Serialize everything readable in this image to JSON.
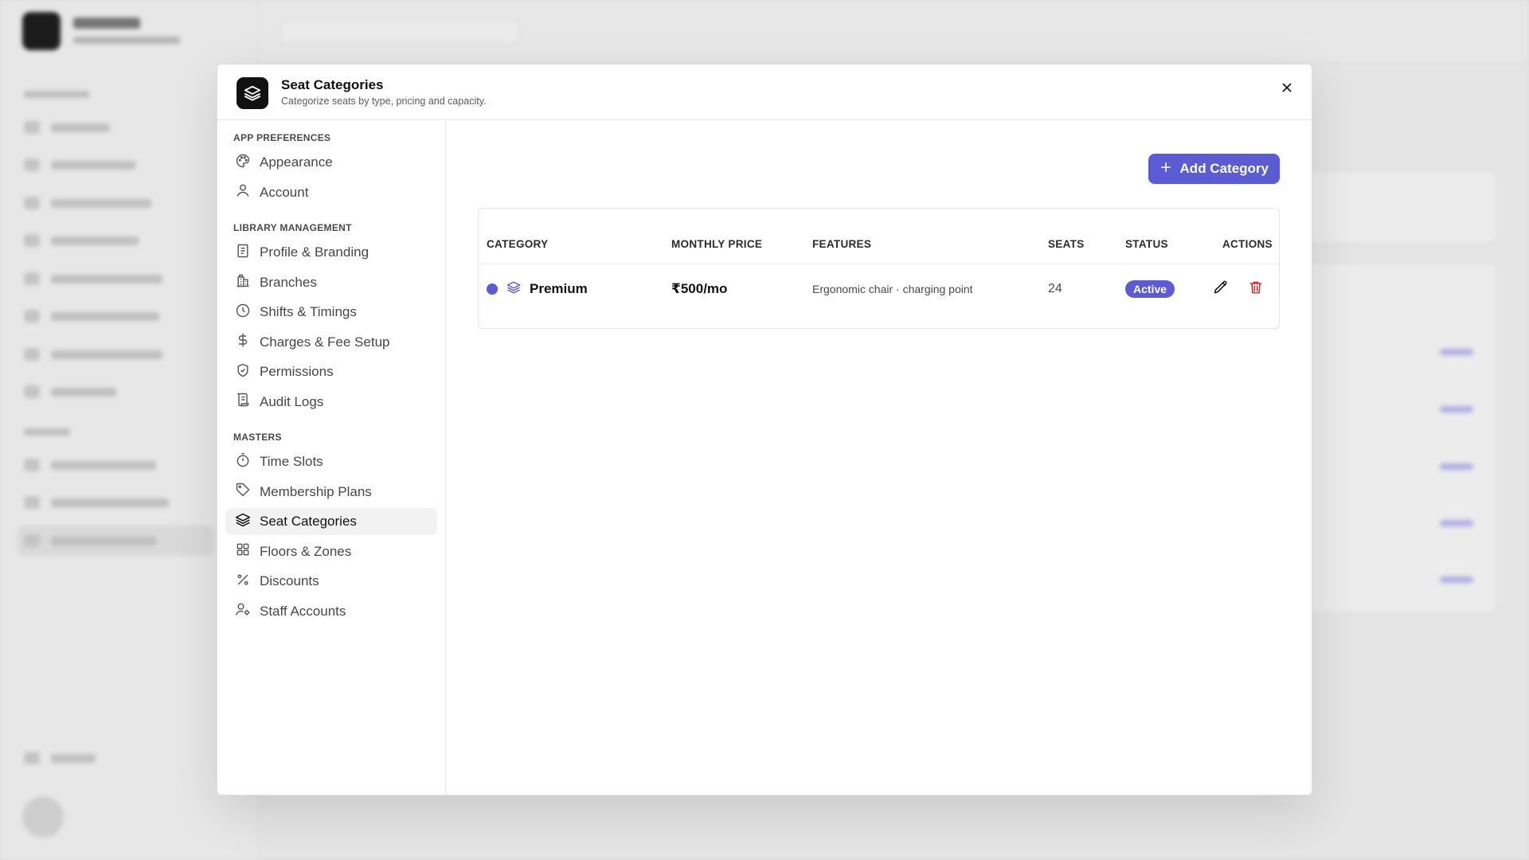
{
  "dialog": {
    "title": "Seat Categories",
    "subtitle": "Categorize seats by type, pricing and capacity.",
    "icon": "layers-icon",
    "close_icon": "close-icon"
  },
  "nav": {
    "sections": [
      {
        "title": "APP PREFERENCES",
        "items": [
          {
            "label": "Appearance",
            "icon": "palette-icon"
          },
          {
            "label": "Account",
            "icon": "user-icon"
          }
        ]
      },
      {
        "title": "LIBRARY MANAGEMENT",
        "items": [
          {
            "label": "Profile & Branding",
            "icon": "document-icon"
          },
          {
            "label": "Branches",
            "icon": "building-icon"
          },
          {
            "label": "Shifts & Timings",
            "icon": "clock-icon"
          },
          {
            "label": "Charges & Fee Setup",
            "icon": "dollar-icon"
          },
          {
            "label": "Permissions",
            "icon": "shield-icon"
          },
          {
            "label": "Audit Logs",
            "icon": "scroll-icon"
          }
        ]
      },
      {
        "title": "MASTERS",
        "items": [
          {
            "label": "Time Slots",
            "icon": "timer-icon"
          },
          {
            "label": "Membership Plans",
            "icon": "tag-icon"
          },
          {
            "label": "Seat Categories",
            "icon": "layers-icon",
            "active": true
          },
          {
            "label": "Floors & Zones",
            "icon": "grid-icon"
          },
          {
            "label": "Discounts",
            "icon": "percent-icon"
          },
          {
            "label": "Staff Accounts",
            "icon": "user-cog-icon"
          }
        ]
      }
    ]
  },
  "toolbar": {
    "add_label": "Add Category",
    "add_icon": "plus-icon"
  },
  "table": {
    "headers": [
      "CATEGORY",
      "MONTHLY PRICE",
      "FEATURES",
      "SEATS",
      "STATUS",
      "ACTIONS"
    ],
    "rows": [
      {
        "color": "#5b5bd6",
        "icon": "layers-icon",
        "category": "Premium",
        "price": "₹500/mo",
        "features": "Ergonomic chair · charging point",
        "seats": "24",
        "status": "Active",
        "edit_icon": "pencil-icon",
        "delete_icon": "trash-icon"
      }
    ]
  },
  "colors": {
    "accent": "#5b5bd6",
    "danger": "#dc2626"
  }
}
